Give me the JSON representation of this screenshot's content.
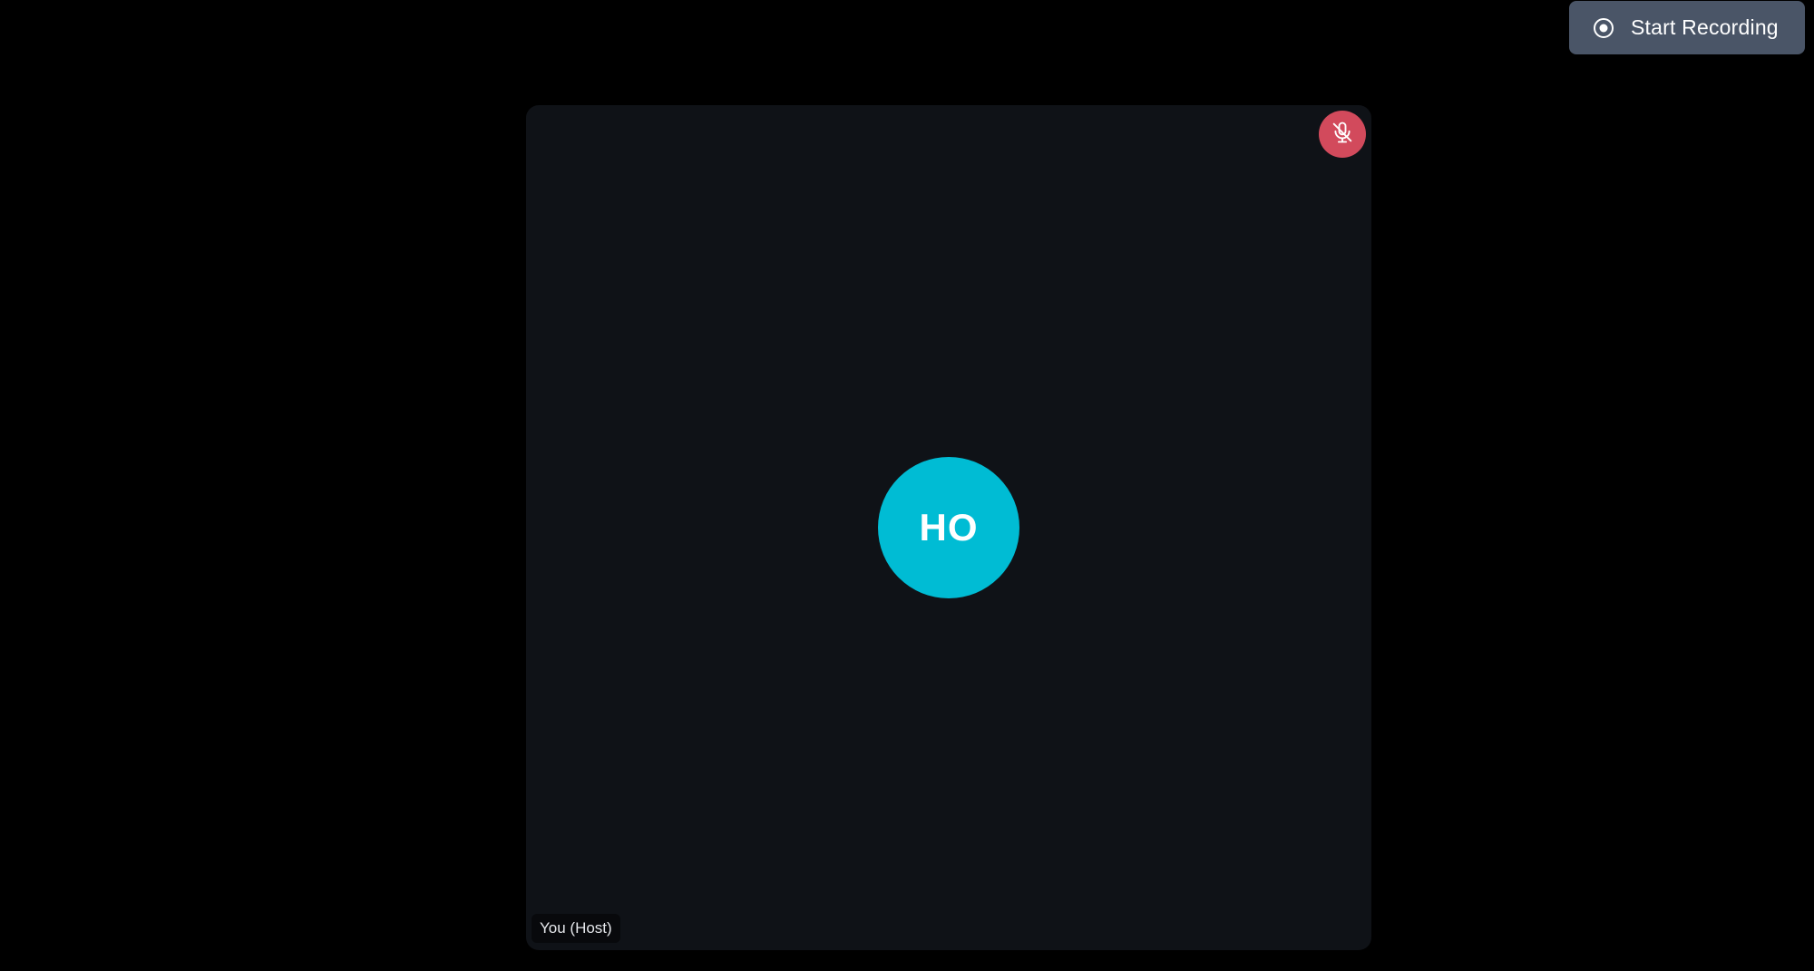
{
  "toolbar": {
    "record_label": "Start Recording",
    "record_icon": "record-icon"
  },
  "participant": {
    "initials": "HO",
    "name_label": "You (Host)",
    "muted": true,
    "mute_icon": "microphone-off-icon",
    "avatar_color": "#00bcd4"
  },
  "colors": {
    "background": "#000000",
    "tile": "#0f1217",
    "record_button": "#4a5567",
    "mute_badge": "#d24a5c"
  }
}
